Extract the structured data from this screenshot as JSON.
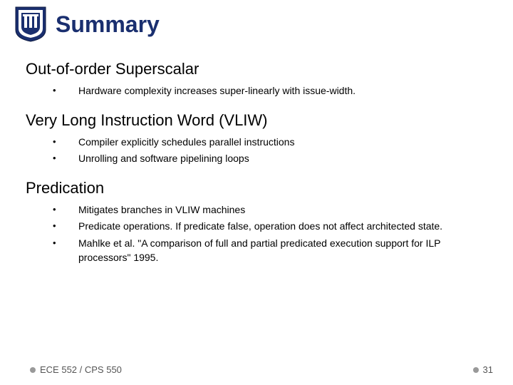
{
  "title": "Summary",
  "sections": [
    {
      "heading": "Out-of-order Superscalar",
      "bullets": [
        "Hardware complexity increases super-linearly with issue-width."
      ]
    },
    {
      "heading": "Very Long Instruction Word (VLIW)",
      "bullets": [
        "Compiler explicitly schedules parallel instructions",
        "Unrolling and software pipelining loops"
      ]
    },
    {
      "heading": "Predication",
      "bullets": [
        "Mitigates branches in VLIW machines",
        "Predicate operations. If predicate false, operation does not affect architected state.",
        "Mahlke et al. \"A comparison of full and partial predicated execution support for ILP processors\" 1995."
      ]
    }
  ],
  "footer": {
    "course": "ECE 552 / CPS 550",
    "page": "31"
  }
}
